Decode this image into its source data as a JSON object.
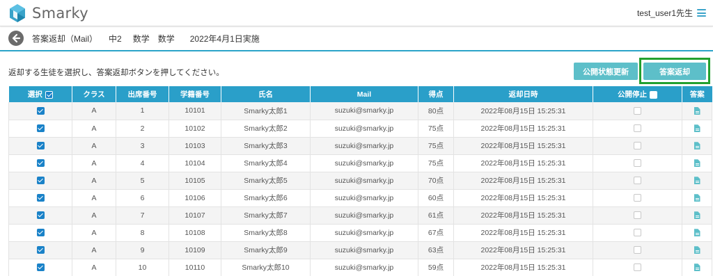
{
  "header": {
    "app_name": "Smarky",
    "user_label": "test_user1先生",
    "colors": {
      "accent": "#2a9fc9",
      "logo": "#3aa3c9"
    }
  },
  "subheader": {
    "crumbs": [
      "答案返却（Mail）",
      "中2",
      "数学",
      "数学",
      "2022年4月1日実施"
    ]
  },
  "instruction": "返却する生徒を選択し、答案返却ボタンを押してください。",
  "buttons": {
    "update_status": "公開状態更新",
    "return_answers": "答案返却"
  },
  "table": {
    "headers": {
      "select": "選択",
      "class": "クラス",
      "attendance_no": "出席番号",
      "student_no": "学籍番号",
      "name": "氏名",
      "mail": "Mail",
      "score": "得点",
      "returned_at": "返却日時",
      "stop_public": "公開停止",
      "answer": "答案"
    },
    "rows": [
      {
        "selected": true,
        "class": "A",
        "attendance_no": "1",
        "student_no": "10101",
        "name": "Smarky太郎1",
        "mail": "suzuki@smarky.jp",
        "score": "80点",
        "returned_at": "2022年08月15日 15:25:31",
        "stopped": false
      },
      {
        "selected": true,
        "class": "A",
        "attendance_no": "2",
        "student_no": "10102",
        "name": "Smarky太郎2",
        "mail": "suzuki@smarky.jp",
        "score": "75点",
        "returned_at": "2022年08月15日 15:25:31",
        "stopped": false
      },
      {
        "selected": true,
        "class": "A",
        "attendance_no": "3",
        "student_no": "10103",
        "name": "Smarky太郎3",
        "mail": "suzuki@smarky.jp",
        "score": "75点",
        "returned_at": "2022年08月15日 15:25:31",
        "stopped": false
      },
      {
        "selected": true,
        "class": "A",
        "attendance_no": "4",
        "student_no": "10104",
        "name": "Smarky太郎4",
        "mail": "suzuki@smarky.jp",
        "score": "75点",
        "returned_at": "2022年08月15日 15:25:31",
        "stopped": false
      },
      {
        "selected": true,
        "class": "A",
        "attendance_no": "5",
        "student_no": "10105",
        "name": "Smarky太郎5",
        "mail": "suzuki@smarky.jp",
        "score": "70点",
        "returned_at": "2022年08月15日 15:25:31",
        "stopped": false
      },
      {
        "selected": true,
        "class": "A",
        "attendance_no": "6",
        "student_no": "10106",
        "name": "Smarky太郎6",
        "mail": "suzuki@smarky.jp",
        "score": "60点",
        "returned_at": "2022年08月15日 15:25:31",
        "stopped": false
      },
      {
        "selected": true,
        "class": "A",
        "attendance_no": "7",
        "student_no": "10107",
        "name": "Smarky太郎7",
        "mail": "suzuki@smarky.jp",
        "score": "61点",
        "returned_at": "2022年08月15日 15:25:31",
        "stopped": false
      },
      {
        "selected": true,
        "class": "A",
        "attendance_no": "8",
        "student_no": "10108",
        "name": "Smarky太郎8",
        "mail": "suzuki@smarky.jp",
        "score": "67点",
        "returned_at": "2022年08月15日 15:25:31",
        "stopped": false
      },
      {
        "selected": true,
        "class": "A",
        "attendance_no": "9",
        "student_no": "10109",
        "name": "Smarky太郎9",
        "mail": "suzuki@smarky.jp",
        "score": "63点",
        "returned_at": "2022年08月15日 15:25:31",
        "stopped": false
      },
      {
        "selected": true,
        "class": "A",
        "attendance_no": "10",
        "student_no": "10110",
        "name": "Smarky太郎10",
        "mail": "suzuki@smarky.jp",
        "score": "59点",
        "returned_at": "2022年08月15日 15:25:31",
        "stopped": false
      }
    ]
  }
}
